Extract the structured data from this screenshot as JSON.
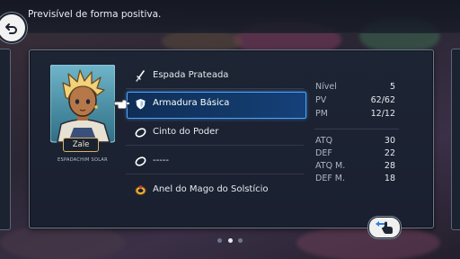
{
  "hint": "Previsível de forma positiva.",
  "character": {
    "name": "Zale",
    "class": "ESPADACHIM SOLAR"
  },
  "equipment": [
    {
      "label": "Espada Prateada",
      "icon": "sword-icon"
    },
    {
      "label": "Armadura Básica",
      "icon": "armor-icon",
      "selected": true
    },
    {
      "label": "Cinto do Poder",
      "icon": "belt-icon"
    },
    {
      "label": "-----",
      "icon": "trinket-icon"
    },
    {
      "label": "Anel do Mago do Solstício",
      "icon": "ring-icon"
    }
  ],
  "stats": {
    "nivel": {
      "label": "Nível",
      "value": "5"
    },
    "pv": {
      "label": "PV",
      "value": "62/62"
    },
    "pm": {
      "label": "PM",
      "value": "12/12"
    },
    "atq": {
      "label": "ATQ",
      "value": "30"
    },
    "def": {
      "label": "DEF",
      "value": "22"
    },
    "atq_m": {
      "label": "ATQ M.",
      "value": "28"
    },
    "def_m": {
      "label": "DEF M.",
      "value": "18"
    }
  },
  "pagination": {
    "total": 3,
    "current": 2
  },
  "colors": {
    "highlight": "#4da3ff",
    "name_border": "#d7b45a"
  }
}
